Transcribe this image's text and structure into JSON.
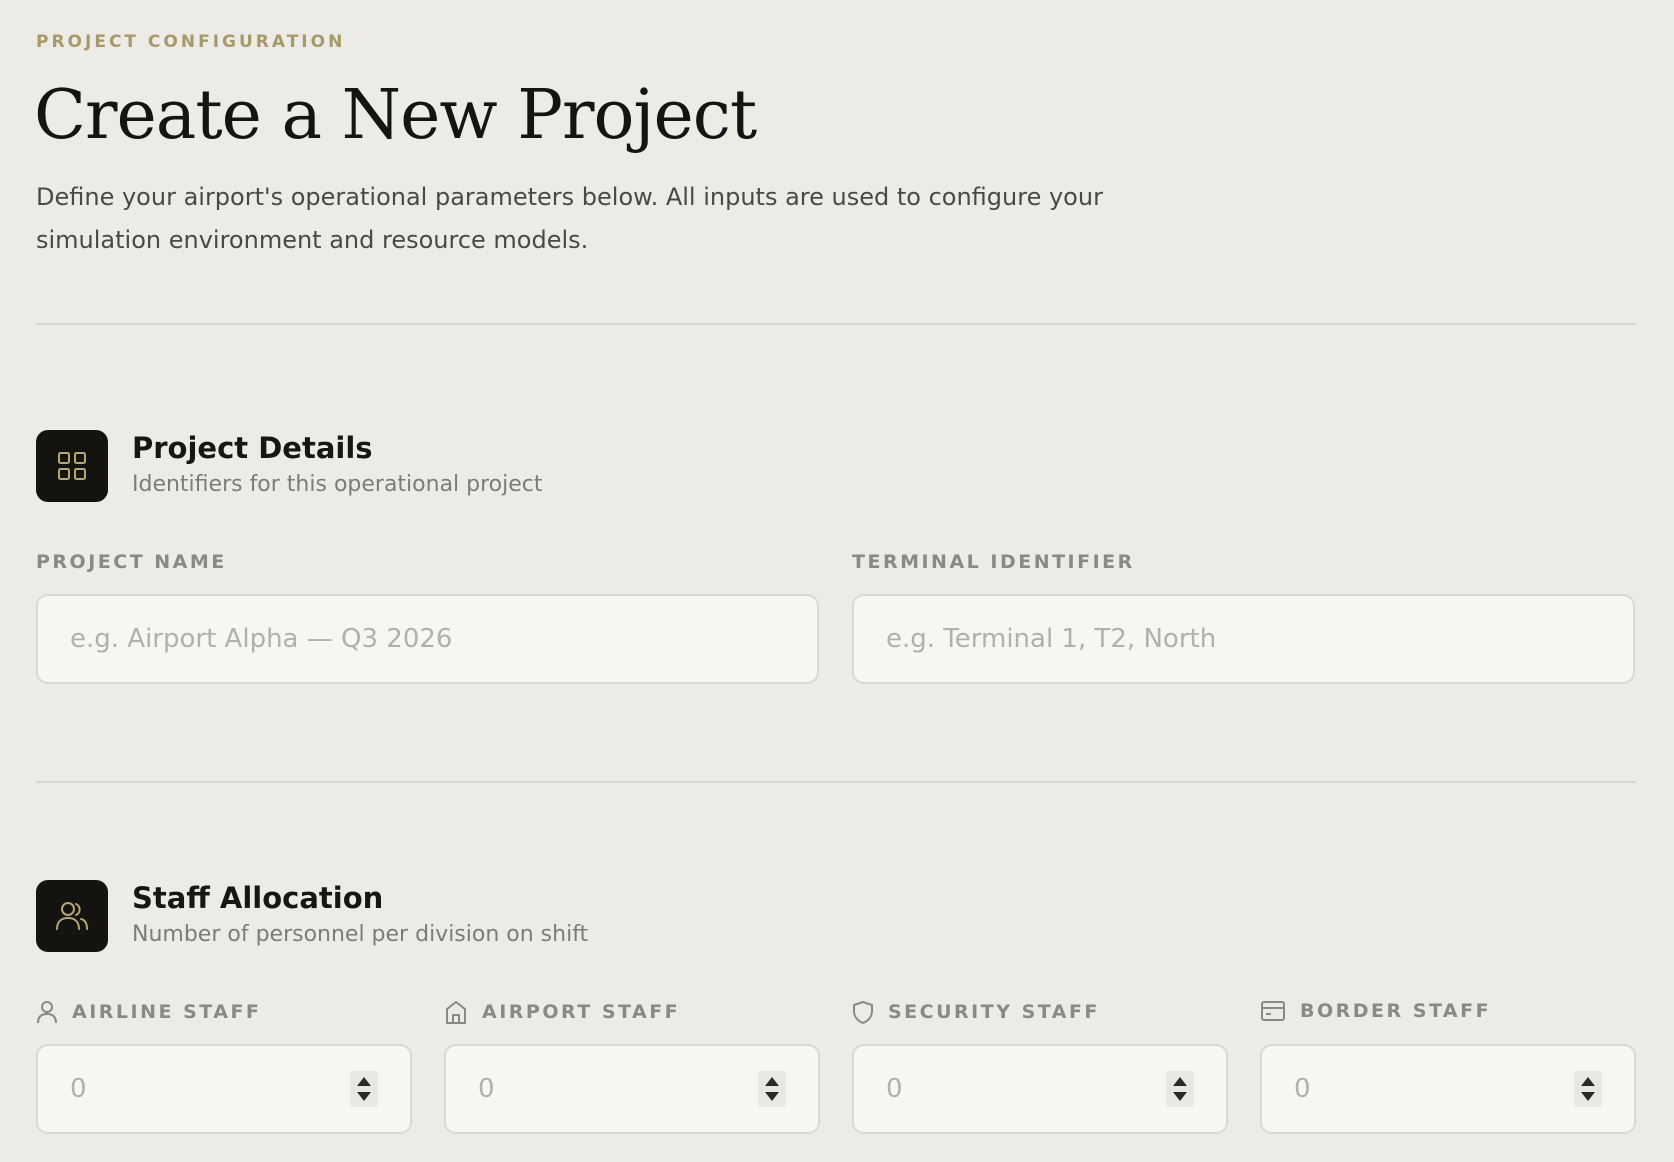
{
  "header": {
    "eyebrow": "PROJECT CONFIGURATION",
    "title": "Create a New Project",
    "subtitle": "Define your airport's operational parameters below. All inputs are used to configure your simulation environment and resource models."
  },
  "project_details": {
    "icon": "grid-icon",
    "title": "Project Details",
    "description": "Identifiers for this operational project",
    "project_name": {
      "label": "PROJECT NAME",
      "placeholder": "e.g. Airport Alpha — Q3 2026"
    },
    "terminal_identifier": {
      "label": "TERMINAL IDENTIFIER",
      "placeholder": "e.g. Terminal 1, T2, North"
    }
  },
  "staff_allocation": {
    "icon": "users-icon",
    "title": "Staff Allocation",
    "description": "Number of personnel per division on shift",
    "fields": [
      {
        "label": "AIRLINE STAFF",
        "icon": "person-icon",
        "value": "0"
      },
      {
        "label": "AIRPORT STAFF",
        "icon": "building-icon",
        "value": "0"
      },
      {
        "label": "SECURITY STAFF",
        "icon": "shield-icon",
        "value": "0"
      },
      {
        "label": "BORDER STAFF",
        "icon": "id-card-icon",
        "value": "0"
      }
    ]
  },
  "colors": {
    "background": "#ecebe5",
    "accent": "#a8996a",
    "icon_tile": "#14130f"
  }
}
